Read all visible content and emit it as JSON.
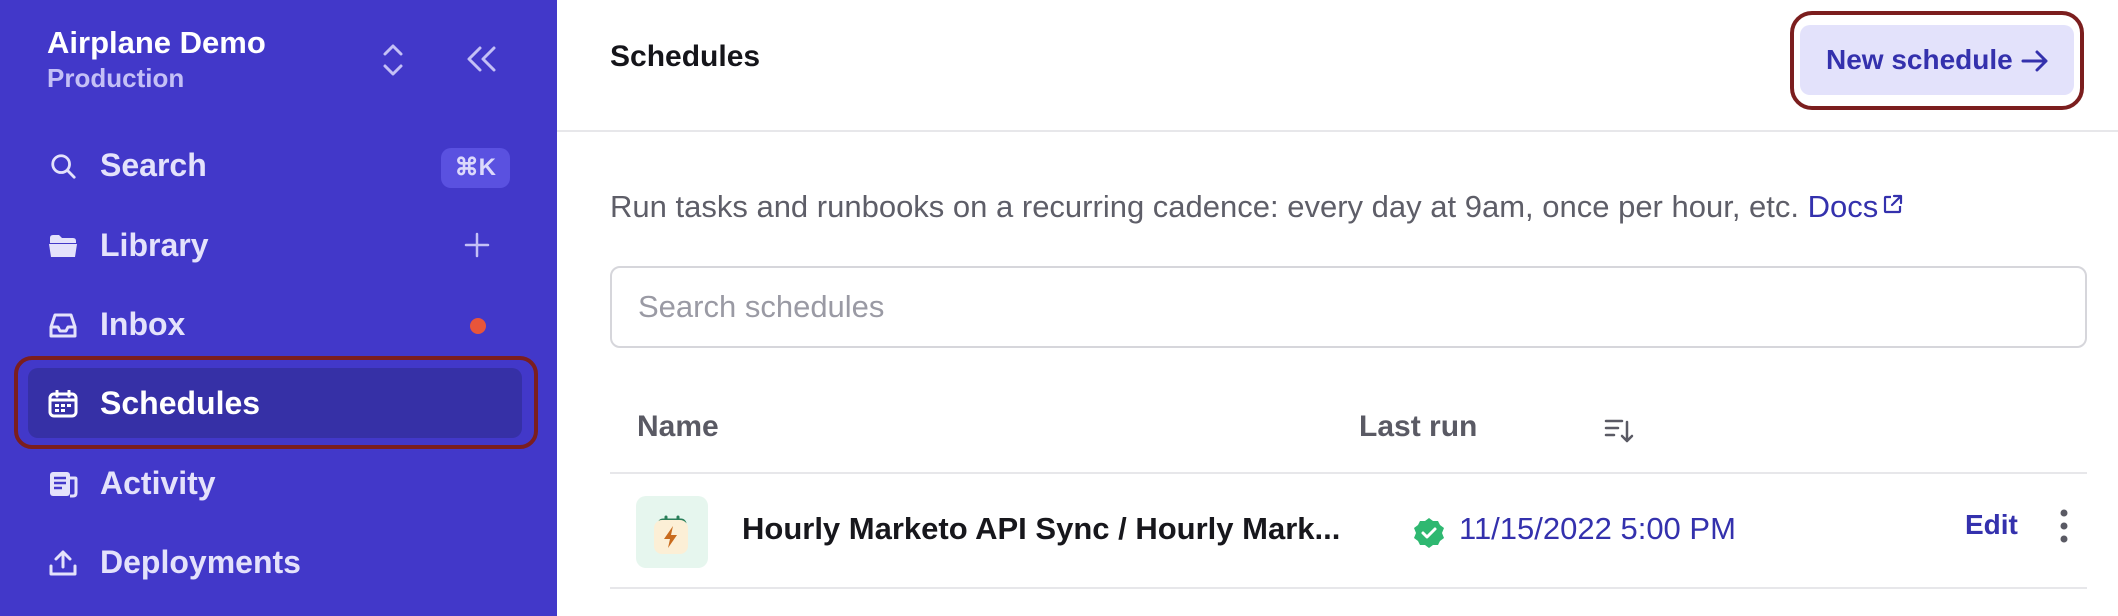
{
  "workspace": {
    "name": "Airplane Demo",
    "environment": "Production"
  },
  "sidebar": {
    "items": [
      {
        "label": "Search",
        "icon": "search-icon",
        "shortcut": "⌘K"
      },
      {
        "label": "Library",
        "icon": "folder-icon"
      },
      {
        "label": "Inbox",
        "icon": "inbox-icon"
      },
      {
        "label": "Schedules",
        "icon": "calendar-icon",
        "active": true
      },
      {
        "label": "Activity",
        "icon": "activity-icon"
      },
      {
        "label": "Deployments",
        "icon": "upload-icon"
      }
    ]
  },
  "header": {
    "title": "Schedules",
    "new_button": "New schedule"
  },
  "description": {
    "text": "Run tasks and runbooks on a recurring cadence: every day at 9am, once per hour, etc.",
    "docs_link": "Docs"
  },
  "search": {
    "placeholder": "Search schedules",
    "value": ""
  },
  "table": {
    "columns": [
      "Name",
      "Last run"
    ],
    "rows": [
      {
        "name": "Hourly Marketo API Sync / Hourly Mark...",
        "last_run": "11/15/2022 5:00 PM",
        "status": "success",
        "action": "Edit"
      }
    ]
  },
  "colors": {
    "sidebar": "#4238c9",
    "accent": "#3431ad",
    "highlight": "#7b1e1e",
    "success": "#2fb871",
    "notification": "#e8553a"
  }
}
